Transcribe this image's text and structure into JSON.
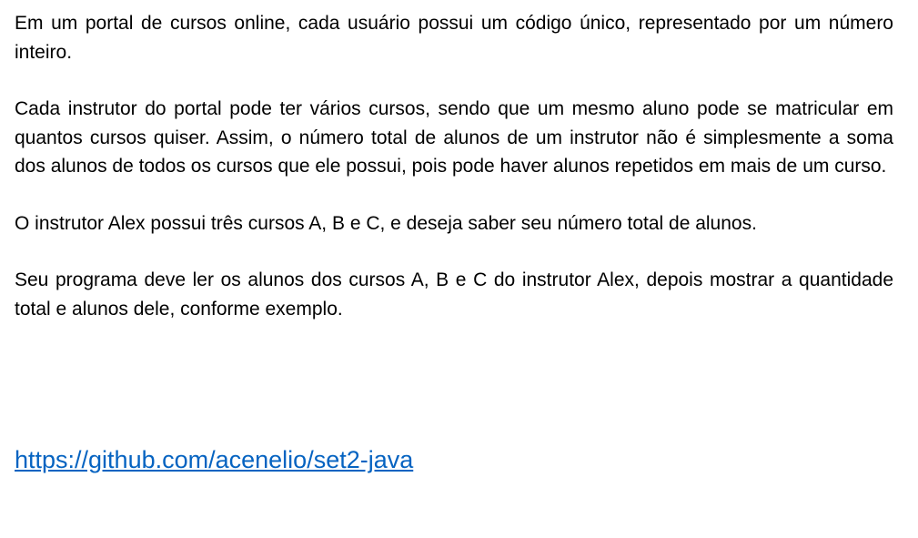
{
  "paragraphs": [
    "Em um portal de cursos online, cada usuário possui um código único, representado por um número inteiro.",
    "Cada instrutor do portal pode ter vários cursos, sendo que um mesmo aluno pode se matricular em quantos cursos quiser. Assim, o número total de alunos de um instrutor não é simplesmente a soma dos alunos de todos os cursos que ele possui, pois pode haver alunos repetidos em mais de um curso.",
    "O instrutor Alex possui três cursos A, B e C, e deseja saber seu número total de alunos.",
    "Seu programa deve ler os alunos dos cursos A, B e C do instrutor Alex, depois mostrar a quantidade total e alunos dele, conforme exemplo."
  ],
  "link": {
    "text": "https://github.com/acenelio/set2-java",
    "color": "#0563c1"
  }
}
